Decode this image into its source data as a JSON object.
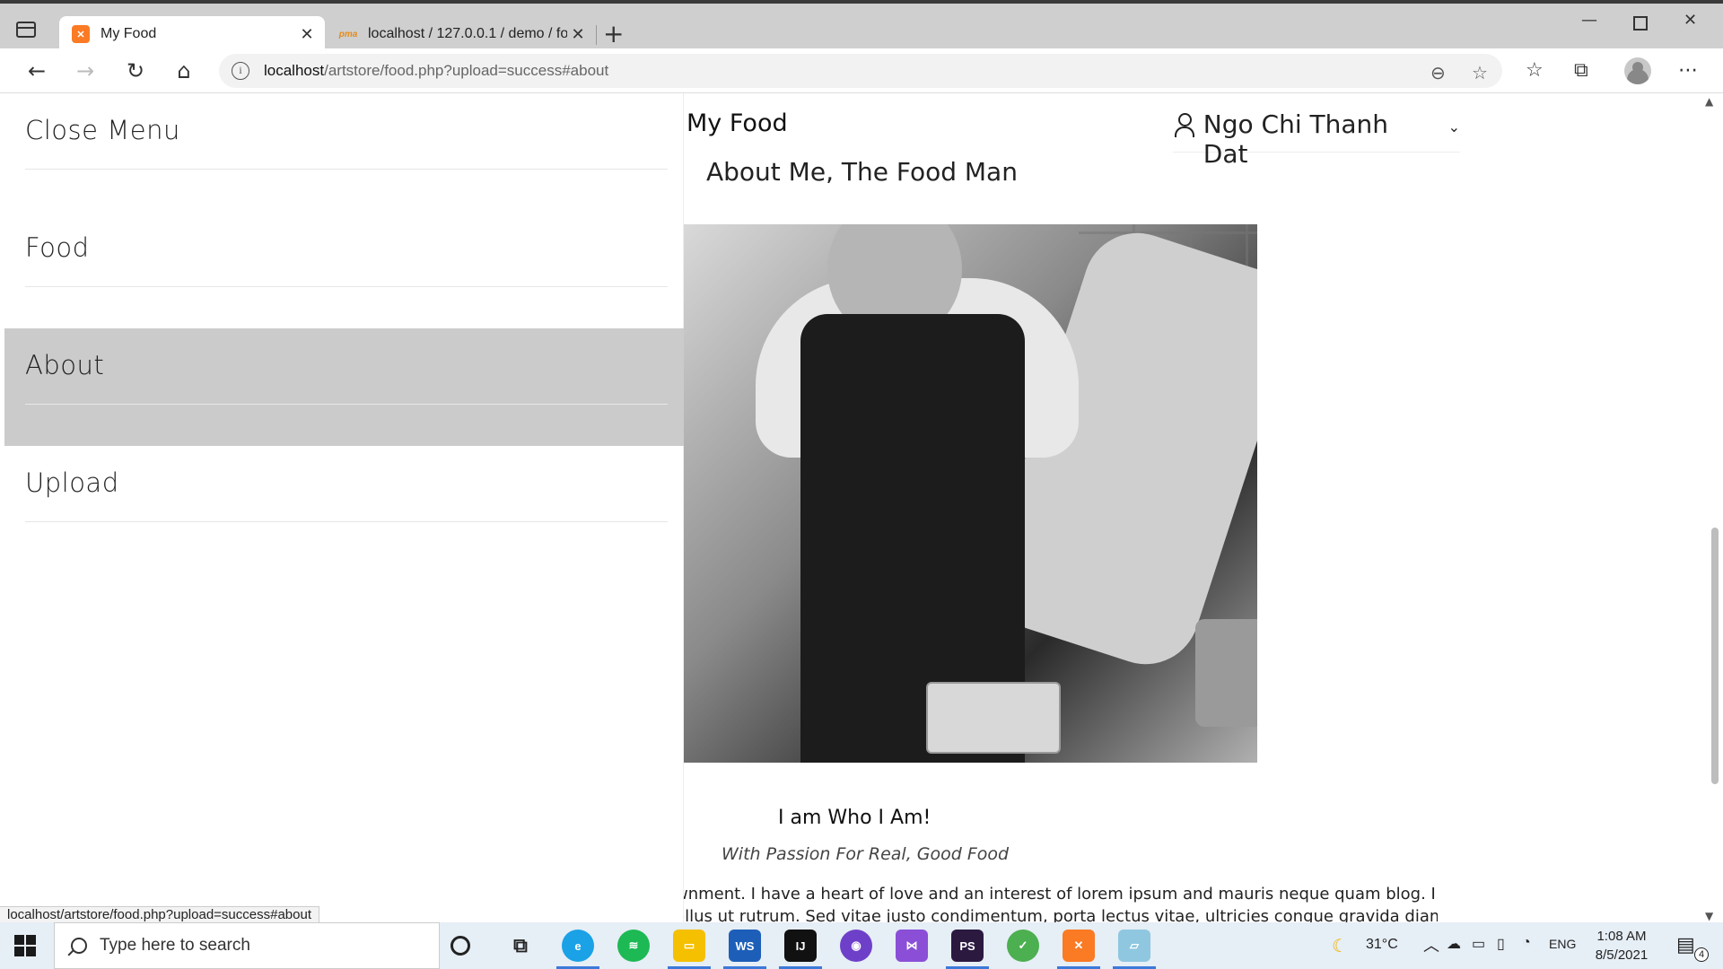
{
  "browser": {
    "tabs": [
      {
        "title": "My Food",
        "favicon": "xampp-icon"
      },
      {
        "title": "localhost / 127.0.0.1 / demo / fo",
        "favicon": "phpmyadmin-icon"
      }
    ],
    "address": {
      "host": "localhost",
      "path": "/artstore/food.php?upload=success#about"
    },
    "status_url": "localhost/artstore/food.php?upload=success#about"
  },
  "sidebar": {
    "items": [
      {
        "label": "Close Menu"
      },
      {
        "label": "Food"
      },
      {
        "label": "About"
      },
      {
        "label": "Upload"
      }
    ],
    "active": "About"
  },
  "header": {
    "brand": "My Food",
    "user_name": "Ngo Chi Thanh Dat"
  },
  "about": {
    "section_title": "About Me, The Food Man",
    "heading": "I am Who I Am!",
    "tagline": "With Passion For Real, Good Food",
    "body_line1": "wnment. I have a heart of love and an interest of lorem ipsum and mauris neque quam blog. I want",
    "body_line2": "ellus ut rutrum. Sed vitae justo condimentum, porta lectus vitae, ultricies congue gravida diam non"
  },
  "taskbar": {
    "search_placeholder": "Type here to search",
    "temperature": "31°C",
    "language": "ENG",
    "time": "1:08 AM",
    "date": "8/5/2021",
    "notification_count": "4"
  },
  "colors": {
    "active_item_bg": "#cbcbcb",
    "xampp_orange": "#fb7a24"
  }
}
